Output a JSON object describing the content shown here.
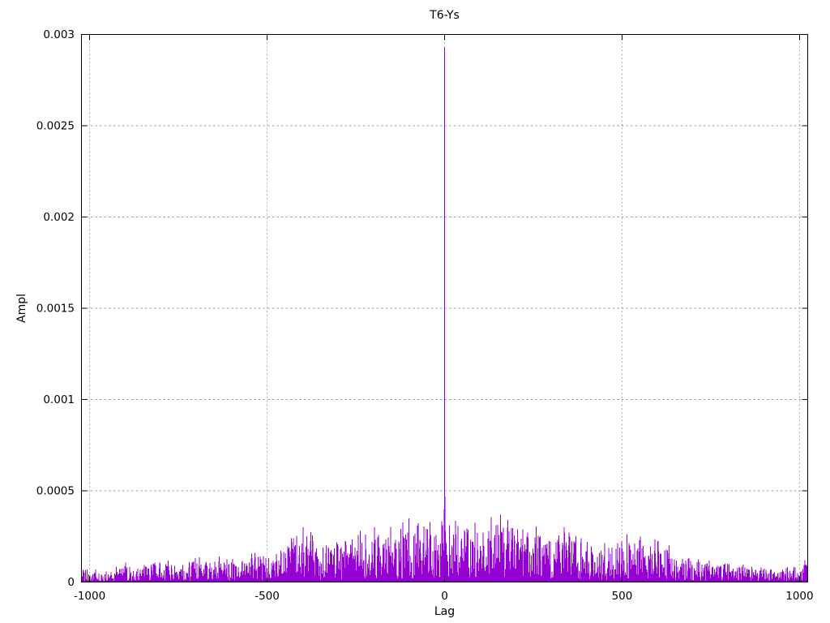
{
  "chart_data": {
    "type": "impulses",
    "title": "T6-Ys",
    "xlabel": "Lag",
    "ylabel": "Ampl",
    "xlim": [
      -1023,
      1023
    ],
    "ylim": [
      0,
      0.003
    ],
    "xticks": {
      "values": [
        -1000,
        -500,
        0,
        500,
        1000
      ],
      "labels": [
        "-1000",
        "-500",
        "0",
        "500",
        "1000"
      ]
    },
    "yticks": {
      "values": [
        0,
        0.0005,
        0.001,
        0.0015,
        0.002,
        0.0025,
        0.003
      ],
      "labels": [
        "0",
        "0.0005",
        "0.001",
        "0.0015",
        "0.002",
        "0.0025",
        "0.003"
      ]
    },
    "grid": true,
    "legend": "none",
    "line_color": "#9400d3",
    "axis_color": "#000000",
    "grid_color": "#9c9c9c",
    "background": "#ffffff",
    "peak": {
      "lag": 0,
      "value": 0.00293
    },
    "notable_spikes": [
      [
        -1,
        0.0004
      ],
      [
        1,
        0.00047
      ],
      [
        2,
        0.00028
      ],
      [
        -41,
        0.00033
      ],
      [
        -100,
        0.00035
      ],
      [
        -197,
        0.0003
      ],
      [
        -237,
        0.00028
      ],
      [
        -399,
        0.0003
      ],
      [
        157,
        0.00037
      ],
      [
        220,
        0.00029
      ],
      [
        337,
        0.0003
      ],
      [
        552,
        0.00025
      ],
      [
        1015,
        0.00012
      ]
    ],
    "noise_envelope": {
      "lags": [
        -1023,
        -950,
        -900,
        -850,
        -800,
        -750,
        -700,
        -650,
        -600,
        -550,
        -500,
        -450,
        -400,
        -350,
        -300,
        -250,
        -200,
        -150,
        -100,
        -50,
        0,
        50,
        100,
        150,
        200,
        250,
        300,
        350,
        400,
        450,
        500,
        550,
        600,
        650,
        700,
        750,
        800,
        850,
        900,
        950,
        1023
      ],
      "max_ampl": [
        7e-05,
        6e-05,
        9e-05,
        8e-05,
        0.00012,
        0.0001,
        0.00012,
        0.00011,
        0.00014,
        0.00013,
        0.00016,
        0.00022,
        0.00028,
        0.0002,
        0.00022,
        0.00024,
        0.00028,
        0.00026,
        0.0003,
        0.00032,
        0.00034,
        0.0003,
        0.00028,
        0.00032,
        0.0003,
        0.00026,
        0.00025,
        0.00028,
        0.00022,
        0.0002,
        0.00022,
        0.00024,
        0.0002,
        0.00016,
        0.00013,
        0.00012,
        0.0001,
        8e-05,
        8e-05,
        7e-05,
        0.0001
      ]
    },
    "noise_seed": 987654321
  }
}
